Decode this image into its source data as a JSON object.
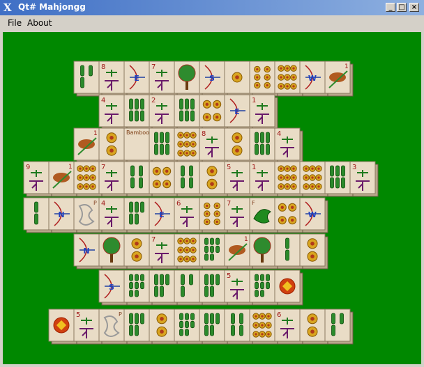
{
  "window": {
    "title": "Qt# Mahjongg",
    "logo_glyph": "X"
  },
  "window_controls": {
    "minimize": "_",
    "maximize": "□",
    "close": "×"
  },
  "menu": {
    "file": "File",
    "about": "About"
  },
  "colors": {
    "felt": "#008800",
    "tile_face": "#e9dcc6",
    "tile_edge": "#b8a78b"
  },
  "tiles": [
    {
      "t": "bamboo",
      "n": 3
    },
    {
      "t": "char",
      "n": "8"
    },
    {
      "t": "wind",
      "n": "E"
    },
    {
      "t": "char",
      "n": "7"
    },
    {
      "t": "tree"
    },
    {
      "t": "wind",
      "n": "S"
    },
    {
      "t": "dots",
      "n": 1
    },
    {
      "t": "dots",
      "n": 6
    },
    {
      "t": "dots",
      "n": 9
    },
    {
      "t": "wind",
      "n": "W"
    },
    {
      "t": "bird",
      "n": "1"
    },
    {
      "t": "char",
      "n": "4"
    },
    {
      "t": "bamboo",
      "n": 6
    },
    {
      "t": "char",
      "n": "2"
    },
    {
      "t": "bamboo",
      "n": 6
    },
    {
      "t": "dots",
      "n": 4
    },
    {
      "t": "wind",
      "n": "E"
    },
    {
      "t": "char",
      "n": "1"
    },
    {
      "t": "bird",
      "n": "1"
    },
    {
      "t": "dots",
      "n": 2
    },
    {
      "t": "bamboo_label",
      "n": "Bamboo"
    },
    {
      "t": "bamboo",
      "n": 6
    },
    {
      "t": "dots",
      "n": 9
    },
    {
      "t": "char",
      "n": "8"
    },
    {
      "t": "dots",
      "n": 2
    },
    {
      "t": "bamboo",
      "n": 6
    },
    {
      "t": "char",
      "n": "4"
    },
    {
      "t": "char",
      "n": "9"
    },
    {
      "t": "bird",
      "n": "1"
    },
    {
      "t": "dots",
      "n": 9
    },
    {
      "t": "char",
      "n": "7"
    },
    {
      "t": "bamboo",
      "n": 4
    },
    {
      "t": "dots",
      "n": 4
    },
    {
      "t": "bamboo",
      "n": 4
    },
    {
      "t": "dots",
      "n": 2
    },
    {
      "t": "char",
      "n": "5"
    },
    {
      "t": "char",
      "n": "1"
    },
    {
      "t": "dots",
      "n": 9
    },
    {
      "t": "dots",
      "n": 9
    },
    {
      "t": "bamboo",
      "n": 6
    },
    {
      "t": "char",
      "n": "3"
    },
    {
      "t": "bamboo",
      "n": 2
    },
    {
      "t": "wind",
      "n": "N"
    },
    {
      "t": "dragon_w",
      "n": "P"
    },
    {
      "t": "char",
      "n": "4"
    },
    {
      "t": "bamboo",
      "n": 5
    },
    {
      "t": "wind",
      "n": "E"
    },
    {
      "t": "char",
      "n": "6"
    },
    {
      "t": "dots",
      "n": 6
    },
    {
      "t": "char",
      "n": "7"
    },
    {
      "t": "dragon_g",
      "n": "F"
    },
    {
      "t": "dots",
      "n": 4
    },
    {
      "t": "wind",
      "n": "W"
    },
    {
      "t": "wind",
      "n": "N"
    },
    {
      "t": "tree"
    },
    {
      "t": "dots",
      "n": 2
    },
    {
      "t": "char",
      "n": "7"
    },
    {
      "t": "dots",
      "n": 9
    },
    {
      "t": "bamboo",
      "n": 8
    },
    {
      "t": "bird",
      "n": "1"
    },
    {
      "t": "tree"
    },
    {
      "t": "bamboo",
      "n": 2
    },
    {
      "t": "dots",
      "n": 2
    },
    {
      "t": "wind",
      "n": "S"
    },
    {
      "t": "bamboo_x",
      "n": 8
    },
    {
      "t": "bamboo",
      "n": 5
    },
    {
      "t": "bamboo",
      "n": 3
    },
    {
      "t": "bamboo",
      "n": 5
    },
    {
      "t": "char",
      "n": "5"
    },
    {
      "t": "bamboo_x",
      "n": 8
    },
    {
      "t": "flower"
    },
    {
      "t": "flower"
    },
    {
      "t": "char",
      "n": "5"
    },
    {
      "t": "dragon_w",
      "n": "P"
    },
    {
      "t": "bamboo",
      "n": 5
    },
    {
      "t": "dots",
      "n": 2
    },
    {
      "t": "bamboo_x",
      "n": 8
    },
    {
      "t": "bamboo",
      "n": 5
    },
    {
      "t": "bamboo",
      "n": 4
    },
    {
      "t": "dots",
      "n": 9
    },
    {
      "t": "char",
      "n": "6"
    },
    {
      "t": "dots",
      "n": 2
    },
    {
      "t": "bamboo",
      "n": 3
    }
  ]
}
